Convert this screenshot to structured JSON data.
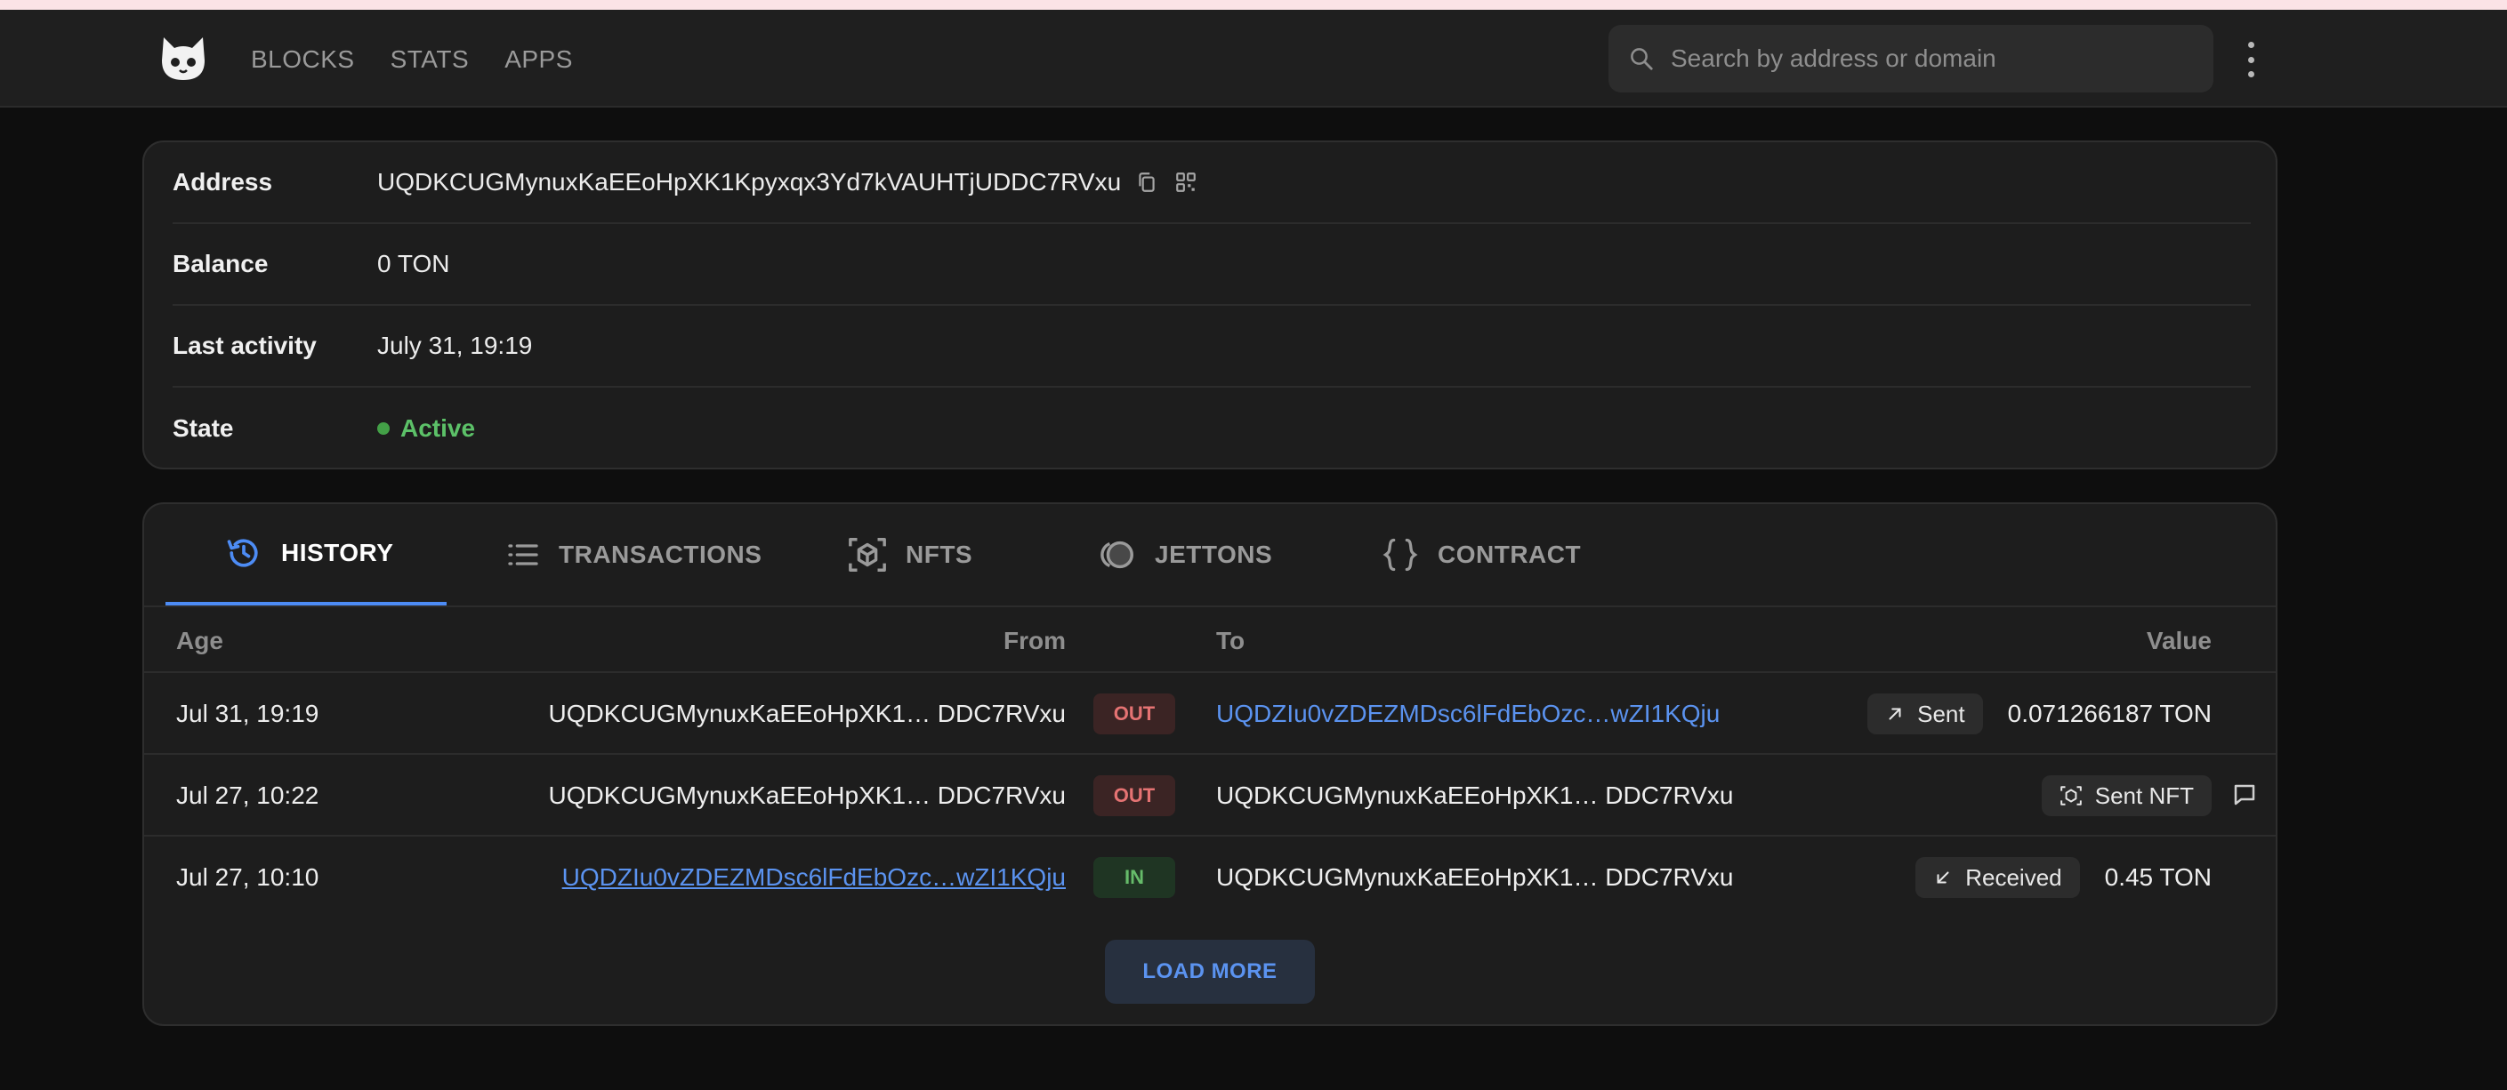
{
  "header": {
    "nav": [
      "BLOCKS",
      "STATS",
      "APPS"
    ],
    "search_placeholder": "Search by address or domain"
  },
  "info": {
    "address_label": "Address",
    "address": "UQDKCUGMynuxKaEEoHpXK1Kpyxqx3Yd7kVAUHTjUDDC7RVxu",
    "balance_label": "Balance",
    "balance": "0 TON",
    "last_activity_label": "Last activity",
    "last_activity": "July 31, 19:19",
    "state_label": "State",
    "state": "Active"
  },
  "tabs": [
    "HISTORY",
    "TRANSACTIONS",
    "NFTS",
    "JETTONS",
    "CONTRACT"
  ],
  "table": {
    "headers": {
      "age": "Age",
      "from": "From",
      "to": "To",
      "value": "Value"
    },
    "rows": [
      {
        "age": "Jul 31, 19:19",
        "from": "UQDKCUGMynuxKaEEoHpXK1… DDC7RVxu",
        "dir": "OUT",
        "to": "UQDZIu0vZDEZMDsc6lFdEbOzc…wZI1KQju",
        "action": "Sent",
        "amount": "0.071266187 TON"
      },
      {
        "age": "Jul 27, 10:22",
        "from": "UQDKCUGMynuxKaEEoHpXK1… DDC7RVxu",
        "dir": "OUT",
        "to": "UQDKCUGMynuxKaEEoHpXK1… DDC7RVxu",
        "action": "Sent NFT",
        "amount": ""
      },
      {
        "age": "Jul 27, 10:10",
        "from": "UQDZIu0vZDEZMDsc6lFdEbOzc…wZI1KQju",
        "dir": "IN",
        "to": "UQDKCUGMynuxKaEEoHpXK1… DDC7RVxu",
        "action": "Received",
        "amount": "0.45 TON"
      }
    ]
  },
  "load_more": "LOAD MORE",
  "colors": {
    "accent": "#5b93f0",
    "active": "#5cc168",
    "out": "#e57373",
    "in": "#66bb6a"
  }
}
